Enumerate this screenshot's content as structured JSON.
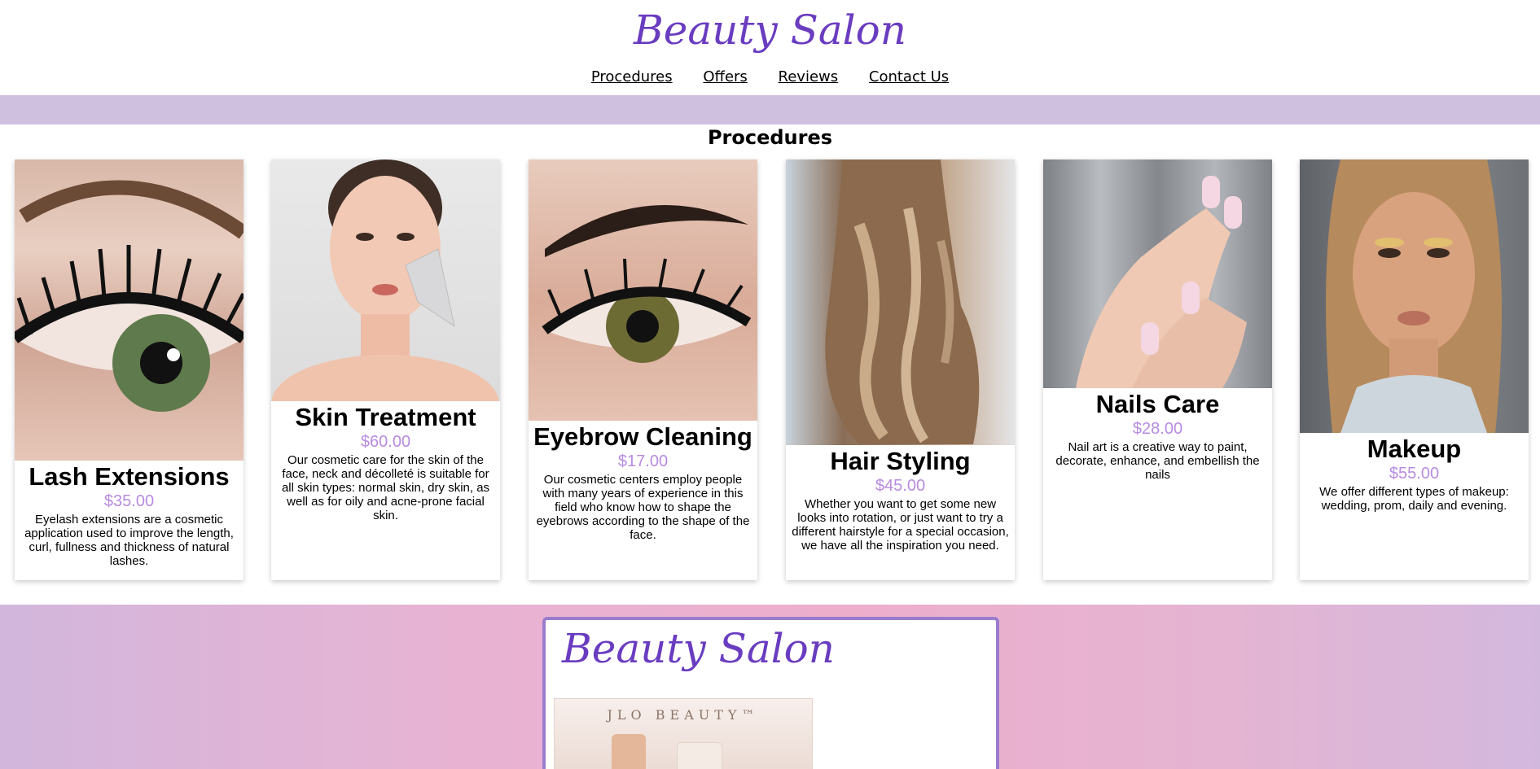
{
  "header": {
    "logo_text": "Beauty Salon",
    "nav": [
      "Procedures",
      "Offers",
      "Reviews",
      "Contact Us"
    ]
  },
  "section": {
    "title": "Procedures"
  },
  "procedures": [
    {
      "name": "Lash Extensions",
      "price": "$35.00",
      "desc": "Eyelash extensions are a cosmetic application used to improve the length, curl, fullness and thickness of natural lashes."
    },
    {
      "name": "Skin Treatment",
      "price": "$60.00",
      "desc": "Our cosmetic care for the skin of the face, neck and décolleté is suitable for all skin types: normal skin, dry skin, as well as for oily and acne-prone facial skin."
    },
    {
      "name": "Eyebrow Cleaning",
      "price": "$17.00",
      "desc": "Our cosmetic centers employ people with many years of experience in this field who know how to shape the eyebrows according to the shape of the face."
    },
    {
      "name": "Hair Styling",
      "price": "$45.00",
      "desc": "Whether you want to get some new looks into rotation, or just want to try a different hairstyle for a special occasion, we have all the inspiration you need."
    },
    {
      "name": "Nails Care",
      "price": "$28.00",
      "desc": "Nail art is a creative way to paint, decorate, enhance, and embellish the nails"
    },
    {
      "name": "Makeup",
      "price": "$55.00",
      "desc": "We offer different types of makeup: wedding, prom, daily and evening."
    }
  ],
  "promo": {
    "logo_text": "Beauty Salon",
    "product_brand": "JLO BEAUTY™"
  },
  "colors": {
    "brand": "#6a3cc0",
    "price": "#b88be0",
    "band": "#cfc0e0"
  }
}
